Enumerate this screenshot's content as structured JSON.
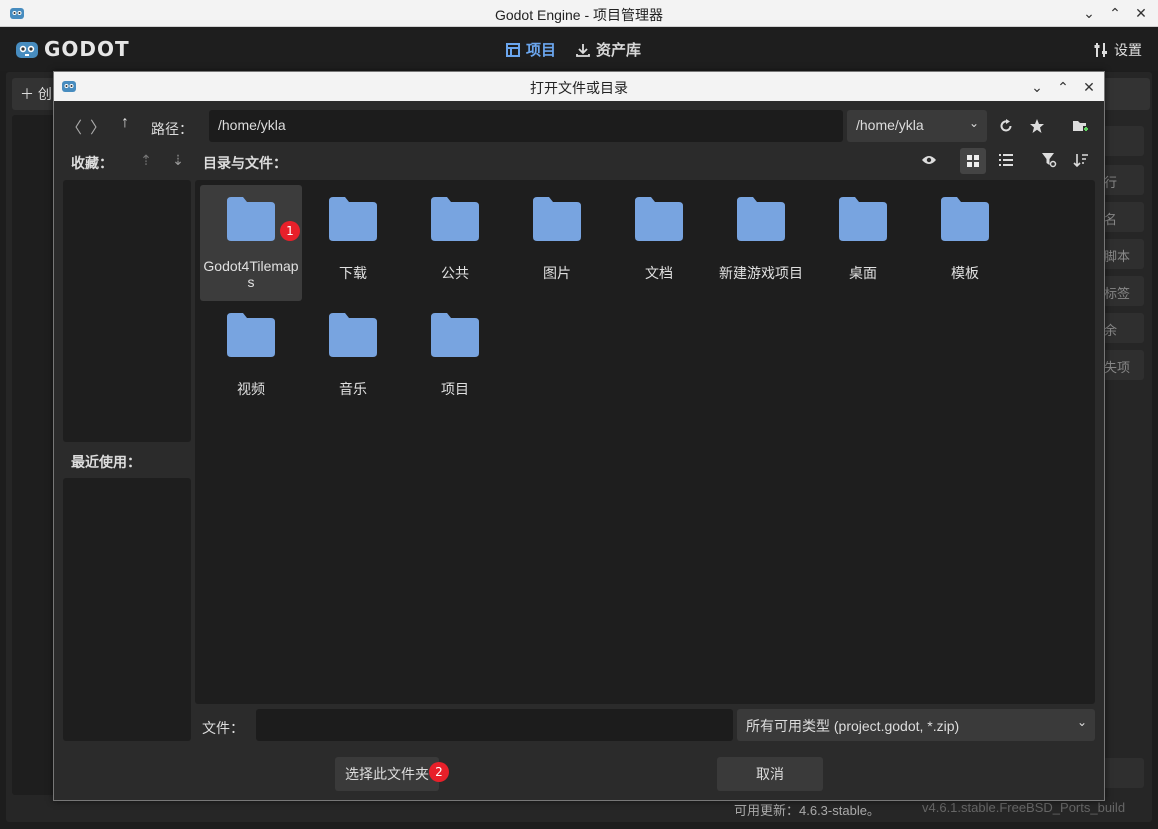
{
  "window": {
    "title": "Godot Engine - 项目管理器",
    "controls": [
      "chevron-down",
      "chevron-up",
      "close"
    ]
  },
  "main_bar": {
    "logo_text": "GODOT",
    "tabs": [
      {
        "label": "项目",
        "icon": "project-list-icon",
        "active": true
      },
      {
        "label": "资产库",
        "icon": "download-icon",
        "active": false
      }
    ],
    "settings_label": "设置"
  },
  "background": {
    "create_label": "创",
    "right_buttons": [
      "行",
      "名",
      "脚本",
      "标签",
      "余",
      "失项"
    ],
    "update_text": "可用更新：4.6.3-stable。",
    "version_text": "v4.6.1.stable.FreeBSD_Ports_build"
  },
  "dialog": {
    "title": "打开文件或目录",
    "path_label": "路径：",
    "path_value": "/home/ykla",
    "path_select_value": "/home/ykla",
    "favorites_label": "收藏：",
    "recent_label": "最近使用：",
    "files_label": "目录与文件：",
    "items": [
      {
        "name": "Godot4Tilemaps",
        "selected": true,
        "badge": "1"
      },
      {
        "name": "下载"
      },
      {
        "name": "公共"
      },
      {
        "name": "图片"
      },
      {
        "name": "文档"
      },
      {
        "name": "新建游戏项目"
      },
      {
        "name": "桌面"
      },
      {
        "name": "模板"
      },
      {
        "name": "视频"
      },
      {
        "name": "音乐"
      },
      {
        "name": "项目"
      }
    ],
    "file_label": "文件：",
    "file_value": "",
    "filter_value": "所有可用类型 (project.godot, *.zip)",
    "select_button_label": "选择此文件夹",
    "select_badge": "2",
    "cancel_button_label": "取消"
  },
  "colors": {
    "accent": "#6ba6ee",
    "folder": "#78a4e0",
    "badge": "#e8202a"
  }
}
